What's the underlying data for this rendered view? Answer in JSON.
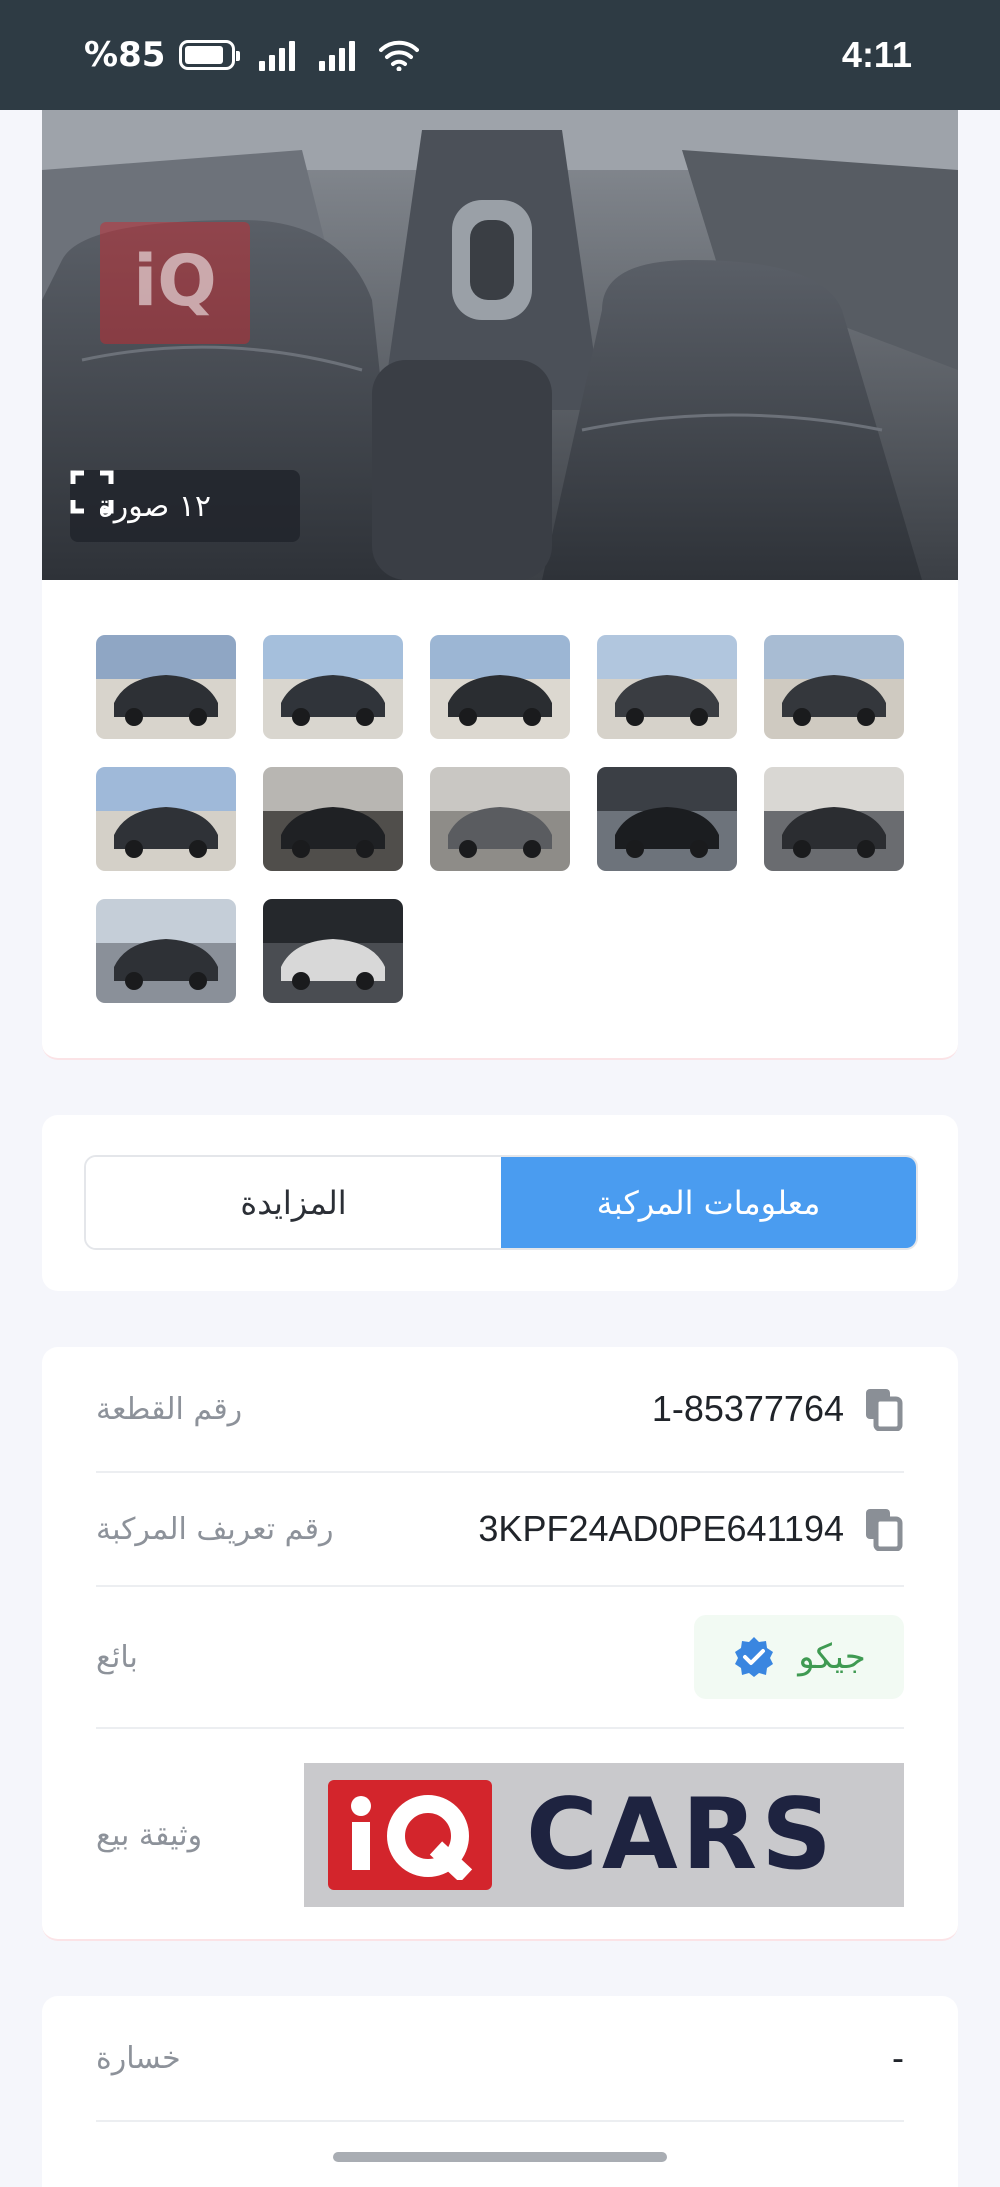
{
  "status_bar": {
    "battery": "%85",
    "time": "4:11"
  },
  "gallery": {
    "photo_count_label": "١٢ صورة",
    "thumbnail_count": 12
  },
  "tabs": {
    "auction": "المزايدة",
    "vehicle_info": "معلومات المركبة",
    "active": "vehicle_info"
  },
  "details": {
    "lot_number_label": "رقم القطعة",
    "lot_number": "1-85377764",
    "vin_label": "رقم تعريف المركبة",
    "vin": "3KPF24AD0PE641194",
    "seller_label": "بائع",
    "seller_name": "جيكو",
    "sale_document_label": "وثيقة بيع",
    "sale_document_logo_text": "CARS"
  },
  "loss": {
    "label": "خسارة",
    "value": "-"
  },
  "colors": {
    "status_bar": "#2e3b44",
    "accent_blue": "#4a9cf0",
    "seller_green": "#3f9a52",
    "logo_red": "#d3252c",
    "logo_navy": "#1e2340"
  }
}
